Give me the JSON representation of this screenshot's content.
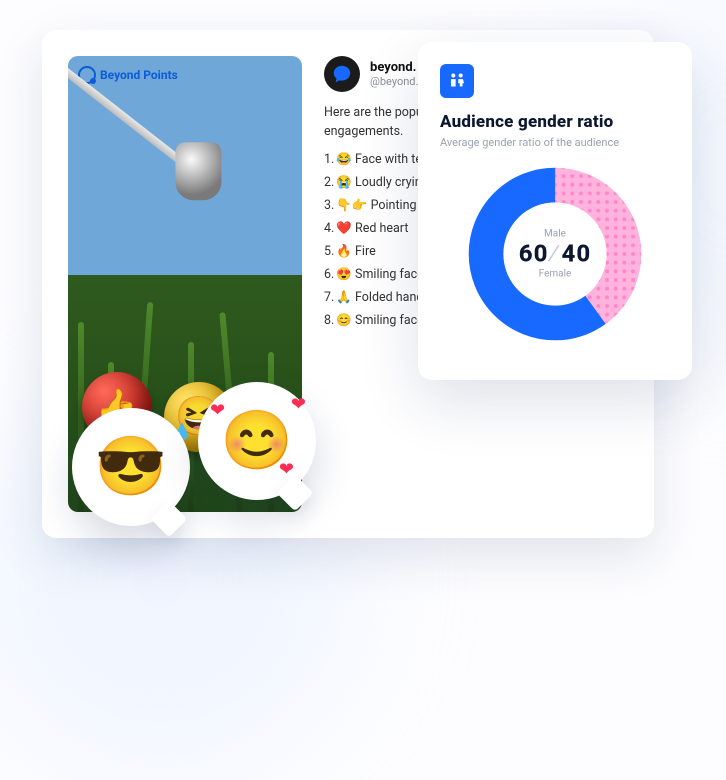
{
  "post": {
    "brand": "Beyond Points",
    "username": "beyond.",
    "handle": "@beyond.",
    "intro": "Here are the popu\nengagements.",
    "items": [
      {
        "num": "1.",
        "emoji": "😂",
        "text": "Face with tea"
      },
      {
        "num": "2.",
        "emoji": "😭",
        "text": "Loudly crying"
      },
      {
        "num": "3.",
        "emoji": "👇👉",
        "text": "Pointing fi"
      },
      {
        "num": "4.",
        "emoji": "❤️",
        "text": "Red heart"
      },
      {
        "num": "5.",
        "emoji": "🔥",
        "text": "Fire"
      },
      {
        "num": "6.",
        "emoji": "😍",
        "text": "Smiling face"
      },
      {
        "num": "7.",
        "emoji": "🙏",
        "text": "Folded hands"
      },
      {
        "num": "8.",
        "emoji": "😊",
        "text": "Smiling face"
      }
    ]
  },
  "gender_card": {
    "title": "Audience gender ratio",
    "subtitle": "Average gender ratio of the audience",
    "male_label": "Male",
    "female_label": "Female",
    "male_value": "60",
    "female_value": "40"
  },
  "chart_data": {
    "type": "pie",
    "title": "Audience gender ratio",
    "series": [
      {
        "name": "Male",
        "value": 60,
        "color": "#1769ff"
      },
      {
        "name": "Female",
        "value": 40,
        "color": "#ff9ad1"
      }
    ]
  },
  "bubbles": {
    "cool": "😎",
    "blush": "😊"
  },
  "ball_emojis": {
    "thumbs": "👍",
    "joy_eyes": "😆"
  }
}
